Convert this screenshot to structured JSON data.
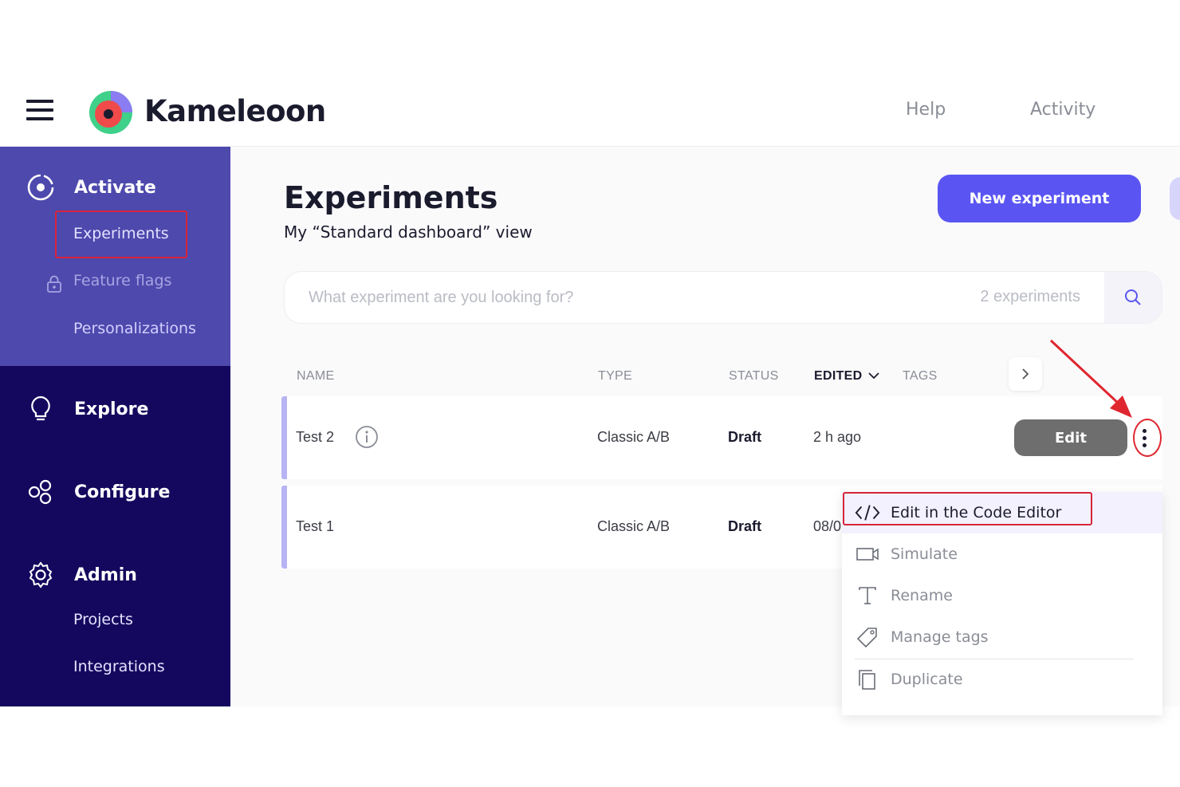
{
  "brand": {
    "name": "Kameleoon",
    "accent": "#5a55f2",
    "sidebar_dark": "#14085e",
    "sidebar_active": "#4e49ad"
  },
  "header": {
    "links": [
      "Help",
      "Activity"
    ]
  },
  "sidebar": {
    "sections": [
      {
        "label": "Activate",
        "icon": "activate-icon",
        "items": [
          "Experiments",
          "Feature flags",
          "Personalizations"
        ]
      },
      {
        "label": "Explore",
        "icon": "lightbulb-icon",
        "items": []
      },
      {
        "label": "Configure",
        "icon": "configure-icon",
        "items": []
      },
      {
        "label": "Admin",
        "icon": "gear-icon",
        "items": [
          "Projects",
          "Integrations"
        ]
      }
    ],
    "selected": "Experiments",
    "locked_item": "Feature flags"
  },
  "main": {
    "title": "Experiments",
    "subtitle": "My “Standard dashboard” view",
    "new_button": "New experiment",
    "search": {
      "placeholder": "What experiment are you looking for?",
      "count": "2 experiments"
    },
    "columns": [
      "NAME",
      "TYPE",
      "STATUS",
      "EDITED",
      "TAGS"
    ],
    "sorted_column": "EDITED",
    "rows": [
      {
        "name": "Test 2",
        "type": "Classic A/B",
        "status": "Draft",
        "edited": "2 h ago"
      },
      {
        "name": "Test 1",
        "type": "Classic A/B",
        "status": "Draft",
        "edited": "08/0"
      }
    ],
    "edit_button": "Edit"
  },
  "context_menu": {
    "items": [
      {
        "label": "Edit in the Code Editor",
        "icon": "code-icon"
      },
      {
        "label": "Simulate",
        "icon": "camera-icon"
      },
      {
        "label": "Rename",
        "icon": "text-icon"
      },
      {
        "label": "Manage tags",
        "icon": "tag-icon"
      },
      {
        "label": "Duplicate",
        "icon": "duplicate-icon"
      }
    ],
    "highlighted": "Edit in the Code Editor"
  },
  "annotations": {
    "highlight_color": "#e0262f"
  }
}
